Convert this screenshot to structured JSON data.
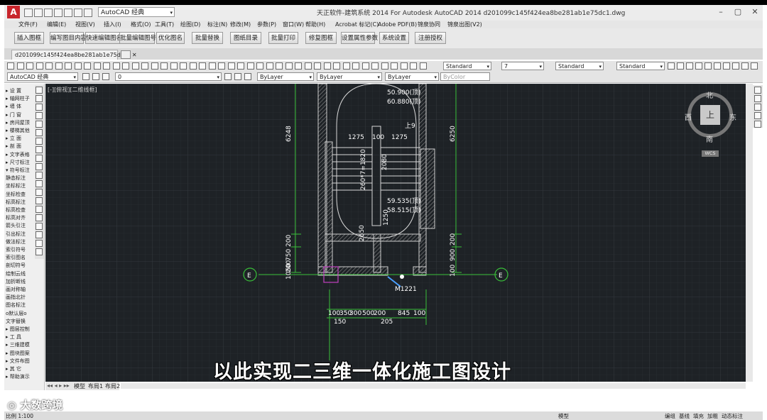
{
  "app": {
    "logo_letter": "A",
    "workspace": "AutoCAD 经典",
    "window_title": "天正软件-建筑系统 2014  For Autodesk AutoCAD 2014    d201099c145f424ea8be281ab1e75dc1.dwg",
    "min": "–",
    "max": "▢",
    "close": "✕"
  },
  "menu": [
    "文件(F)",
    "编辑(E)",
    "视图(V)",
    "插入(I)",
    "格式(O)",
    "工具(T)",
    "绘图(D)",
    "标注(N)",
    "修改(M)",
    "参数(P)",
    "窗口(W)",
    "帮助(H)",
    "Acrobat 标记(C)",
    "Adobe PDF(B)",
    "锦泉协同",
    "锦泉出图(V2)"
  ],
  "ribbon_buttons": [
    "插入图框",
    "编写图目内容",
    "快速编辑图名",
    "批量编辑图号",
    "优化图名",
    "批量替换",
    "图纸目录",
    "批量打印",
    "修复图框",
    "设置属性参数",
    "系统设置",
    "注册授权"
  ],
  "document_tab": "d201099c145f424ea8be281ab1e75dc1*",
  "toolbar": {
    "text_style": "Standard",
    "dim_scale": "7",
    "dim_style": "Standard",
    "table_style": "Standard",
    "workspace2": "AutoCAD 经典",
    "layer": "0",
    "color": "ByLayer",
    "linetype": "ByLayer",
    "lineweight": "ByLayer",
    "plotstyle": "ByColor"
  },
  "left_panel_items": [
    "▸ 设    置",
    "▸ 轴网柱子",
    "▸ 墙    体",
    "▸ 门    窗",
    "▸ 房间屋顶",
    "▸ 楼梯其他",
    "▸ 立    面",
    "▸ 剖    面",
    "▸ 文字表格",
    "▸ 尺寸标注",
    "▾ 符号标注",
    "   静态标注",
    "   坐标标注",
    "   坐标检查",
    "   标高标注",
    "   标高检查",
    "   标高对齐",
    "   箭头引注",
    "   引出标注",
    "   做法标注",
    "   索引符号",
    "   索引图名",
    "   剖切符号",
    "   绘制云线",
    "   加折断线",
    "   画对称轴",
    "   画指北针",
    "   图名标注",
    "   o默认层o",
    "   文字替换",
    "▸ 图层控制",
    "▸ 工    具",
    "▸ 三维建模",
    "▸ 图块图案",
    "▸ 文件布图",
    "▸ 其    它",
    "▸ 帮助演示"
  ],
  "viewport_label": "[-][俯视][二维线框]",
  "compass": {
    "north": "北",
    "south": "南",
    "east": "东",
    "west": "西",
    "top": "上",
    "wcs": "WCS"
  },
  "drawing": {
    "axis_label": "E",
    "dims_left": [
      "6248",
      "200",
      "750",
      "200",
      "1050"
    ],
    "dims_right": [
      "6250",
      "200",
      "900",
      "100"
    ],
    "elevations": [
      "50.900(顶)",
      "60.880(顶)",
      "59.535(顶)",
      "58.515(顶)"
    ],
    "stair_top": [
      "1275",
      "100",
      "1275"
    ],
    "stair_mid": [
      "260*7=1820",
      "2080",
      "1250",
      "2650"
    ],
    "door": "M1221",
    "bottom_dims_row1": [
      "100",
      "350",
      "300",
      "500",
      "200",
      "845",
      "100"
    ],
    "bottom_dims_row2": [
      "150",
      "205"
    ],
    "north_arrow_ud": "上9"
  },
  "layout_tabs": [
    "模型",
    "布局1",
    "布局2"
  ],
  "subtitle": "以此实现二三维一体化施工图设计",
  "watermark": "大数跨境",
  "status": {
    "scale": "比例 1:100",
    "model": "模型",
    "items": [
      "编组",
      "基线",
      "填充",
      "加粗",
      "动态标注"
    ]
  }
}
